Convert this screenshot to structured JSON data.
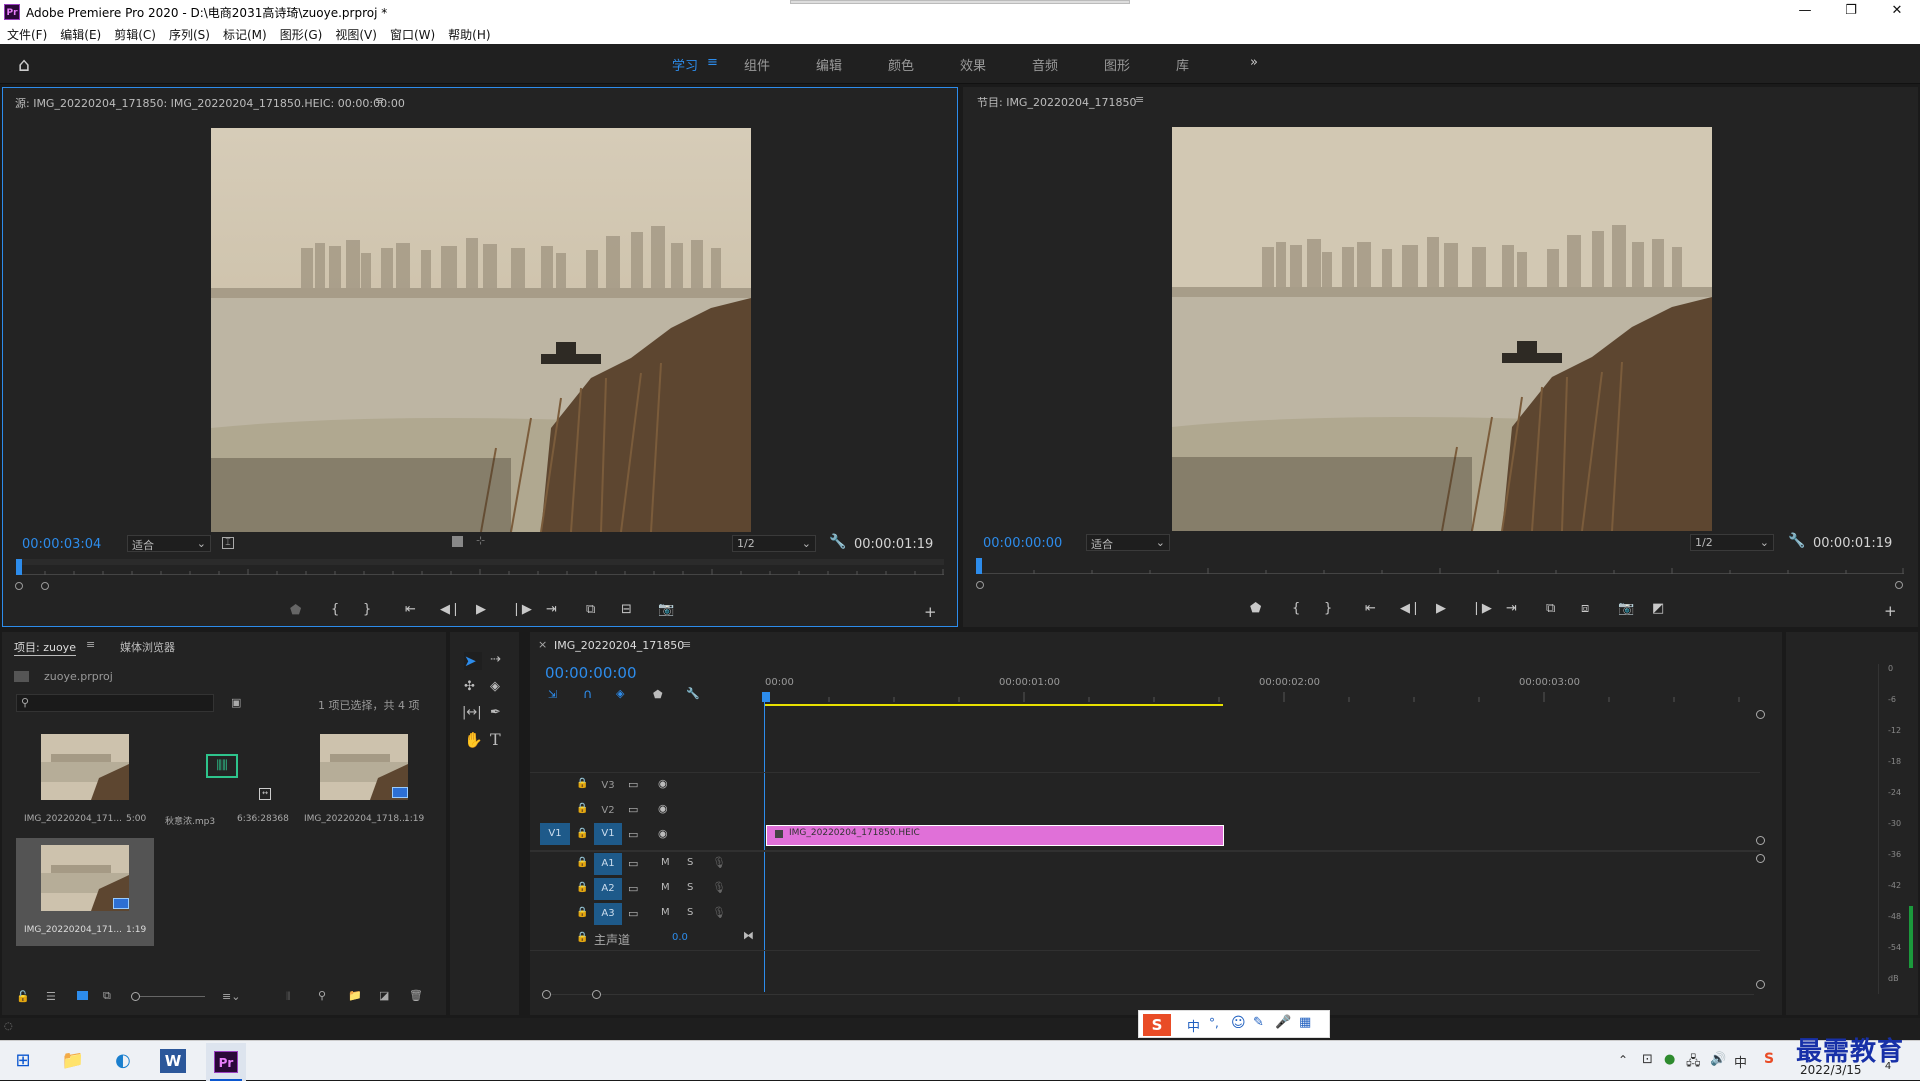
{
  "app": {
    "title": "Adobe Premiere Pro 2020 - D:\\电商2031高诗琦\\zuoye.prproj *",
    "icon": "Pr"
  },
  "window_controls": {
    "min": "—",
    "max": "❐",
    "close": "✕"
  },
  "menu": [
    "文件(F)",
    "编辑(E)",
    "剪辑(C)",
    "序列(S)",
    "标记(M)",
    "图形(G)",
    "视图(V)",
    "窗口(W)",
    "帮助(H)"
  ],
  "workspaces": {
    "items": [
      "学习",
      "组件",
      "编辑",
      "颜色",
      "效果",
      "音频",
      "图形",
      "库"
    ],
    "active": "学习",
    "more": "»"
  },
  "source_monitor": {
    "title": "源: IMG_20220204_171850: IMG_20220204_171850.HEIC: 00:00:00:00",
    "timecode": "00:00:03:04",
    "fit": "适合",
    "res": "1/2",
    "duration": "00:00:01:19"
  },
  "program_monitor": {
    "title": "节目: IMG_20220204_171850",
    "timecode": "00:00:00:00",
    "fit": "适合",
    "res": "1/2",
    "duration": "00:00:01:19"
  },
  "project": {
    "tab_active": "项目: zuoye",
    "tab_other": "媒体浏览器",
    "file": "zuoye.prproj",
    "selection_info": "1 项已选择，共 4 项",
    "items": [
      {
        "name": "IMG_20220204_171...",
        "duration": "5:00",
        "kind": "image"
      },
      {
        "name": "秋意浓.mp3",
        "duration": "6:36:28368",
        "kind": "audio"
      },
      {
        "name": "IMG_20220204_1718...",
        "duration": "1:19",
        "kind": "sequence"
      },
      {
        "name": "IMG_20220204_171...",
        "duration": "1:19",
        "kind": "sequence",
        "selected": true
      }
    ]
  },
  "timeline": {
    "tab": "IMG_20220204_171850",
    "close": "×",
    "timecode": "00:00:00:00",
    "ruler": [
      "00:00",
      "00:00:01:00",
      "00:00:02:00",
      "00:00:03:00"
    ],
    "video_tracks": [
      "V3",
      "V2",
      "V1"
    ],
    "source_patch": "V1",
    "audio_tracks": [
      "A1",
      "A2",
      "A3"
    ],
    "master": {
      "label": "主声道",
      "value": "0.0"
    },
    "clip": {
      "name": "IMG_20220204_171850.HEIC",
      "color": "#e070d8"
    }
  },
  "audio_meter": {
    "ticks": [
      "0",
      "-6",
      "-12",
      "-18",
      "-24",
      "-30",
      "-36",
      "-42",
      "-48",
      "-54",
      "dB"
    ]
  },
  "ime": {
    "items": [
      "中",
      "°,",
      "☺",
      "✎",
      "🎤",
      "▦"
    ]
  },
  "taskbar": {
    "date": "2022/3/15",
    "watermark": "最需教育",
    "badge": "4"
  },
  "colors": {
    "accent": "#2d8ceb",
    "clip": "#e070d8",
    "work_area": "#e8e000",
    "panel_border_active": "#2d8ceb"
  }
}
